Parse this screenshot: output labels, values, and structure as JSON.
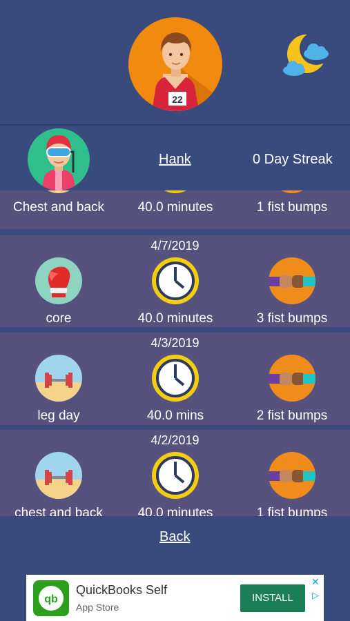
{
  "header": {
    "avatar_icon": "runner-avatar-icon",
    "bib_number": "22",
    "weather_icon": "moon-cloud-icon"
  },
  "profile": {
    "avatar_icon": "snorkel-avatar-icon",
    "name": "Hank",
    "streak": "0 Day Streak"
  },
  "workouts": [
    {
      "date": "",
      "activity": "Chest and back",
      "activity_icon": "activity-icon",
      "duration": "40.0 minutes",
      "fist_bumps": "1 fist bumps"
    },
    {
      "date": "4/7/2019",
      "activity": "core",
      "activity_icon": "boxing-glove-icon",
      "duration": "40.0 minutes",
      "fist_bumps": "3 fist bumps"
    },
    {
      "date": "4/3/2019",
      "activity": "leg day",
      "activity_icon": "dumbbell-beach-icon",
      "duration": "40.0 mins",
      "fist_bumps": "2 fist bumps"
    },
    {
      "date": "4/2/2019",
      "activity": "chest and back",
      "activity_icon": "dumbbell-beach-icon",
      "duration": "40.0 minutes",
      "fist_bumps": "1 fist bumps"
    }
  ],
  "nav": {
    "back_label": "Back"
  },
  "ad": {
    "title": "QuickBooks Self",
    "subtitle": "App Store",
    "install_label": "INSTALL",
    "logo_text": "qb",
    "close_glyph": "✕",
    "adchoices_glyph": "▷"
  },
  "colors": {
    "background": "#394a7c",
    "card": "#56517d",
    "accent_orange": "#f28a0f",
    "timer_yellow": "#f3cd12",
    "install_green": "#1a7f57"
  }
}
